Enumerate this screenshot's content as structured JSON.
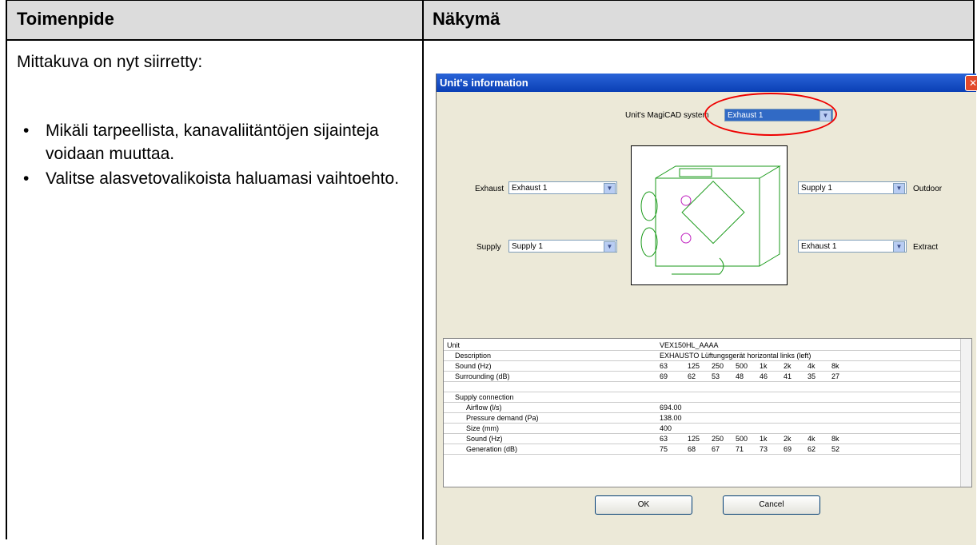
{
  "header": {
    "col1": "Toimenpide",
    "col2": "Näkymä"
  },
  "left": {
    "intro": "Mittakuva on nyt siirretty:",
    "bullets": [
      "Mikäli tarpeellista, kanavaliitäntöjen sijainteja voidaan muuttaa.",
      "Valitse alasvetovalikoista haluamasi vaihtoehto."
    ]
  },
  "dialog": {
    "title": "Unit's information",
    "system_label": "Unit's MagiCAD system",
    "system_value": "Exhaust 1",
    "exhaust_label": "Exhaust",
    "exhaust_value": "Exhaust 1",
    "supply_label": "Supply",
    "supply_value": "Supply 1",
    "right_top_value": "Supply 1",
    "outdoor_label": "Outdoor",
    "right_bottom_value": "Exhaust 1",
    "extract_label": "Extract",
    "ok": "OK",
    "cancel": "Cancel",
    "rows": [
      [
        "Unit",
        "VEX150HL_AAAA"
      ],
      [
        "Description",
        "EXHAUSTO Lüftungsgerät horizontal links (left)"
      ],
      [
        "Sound (Hz)",
        "63",
        "125",
        "250",
        "500",
        "1k",
        "2k",
        "4k",
        "8k"
      ],
      [
        "Surrounding (dB)",
        "69",
        "62",
        "53",
        "48",
        "46",
        "41",
        "35",
        "27"
      ],
      [
        ""
      ],
      [
        "Supply connection"
      ],
      [
        "Airflow (l/s)",
        "694.00"
      ],
      [
        "Pressure demand (Pa)",
        "138.00"
      ],
      [
        "Size (mm)",
        "400"
      ],
      [
        "Sound (Hz)",
        "63",
        "125",
        "250",
        "500",
        "1k",
        "2k",
        "4k",
        "8k"
      ],
      [
        "Generation (dB)",
        "75",
        "68",
        "67",
        "71",
        "73",
        "69",
        "62",
        "52"
      ]
    ]
  }
}
